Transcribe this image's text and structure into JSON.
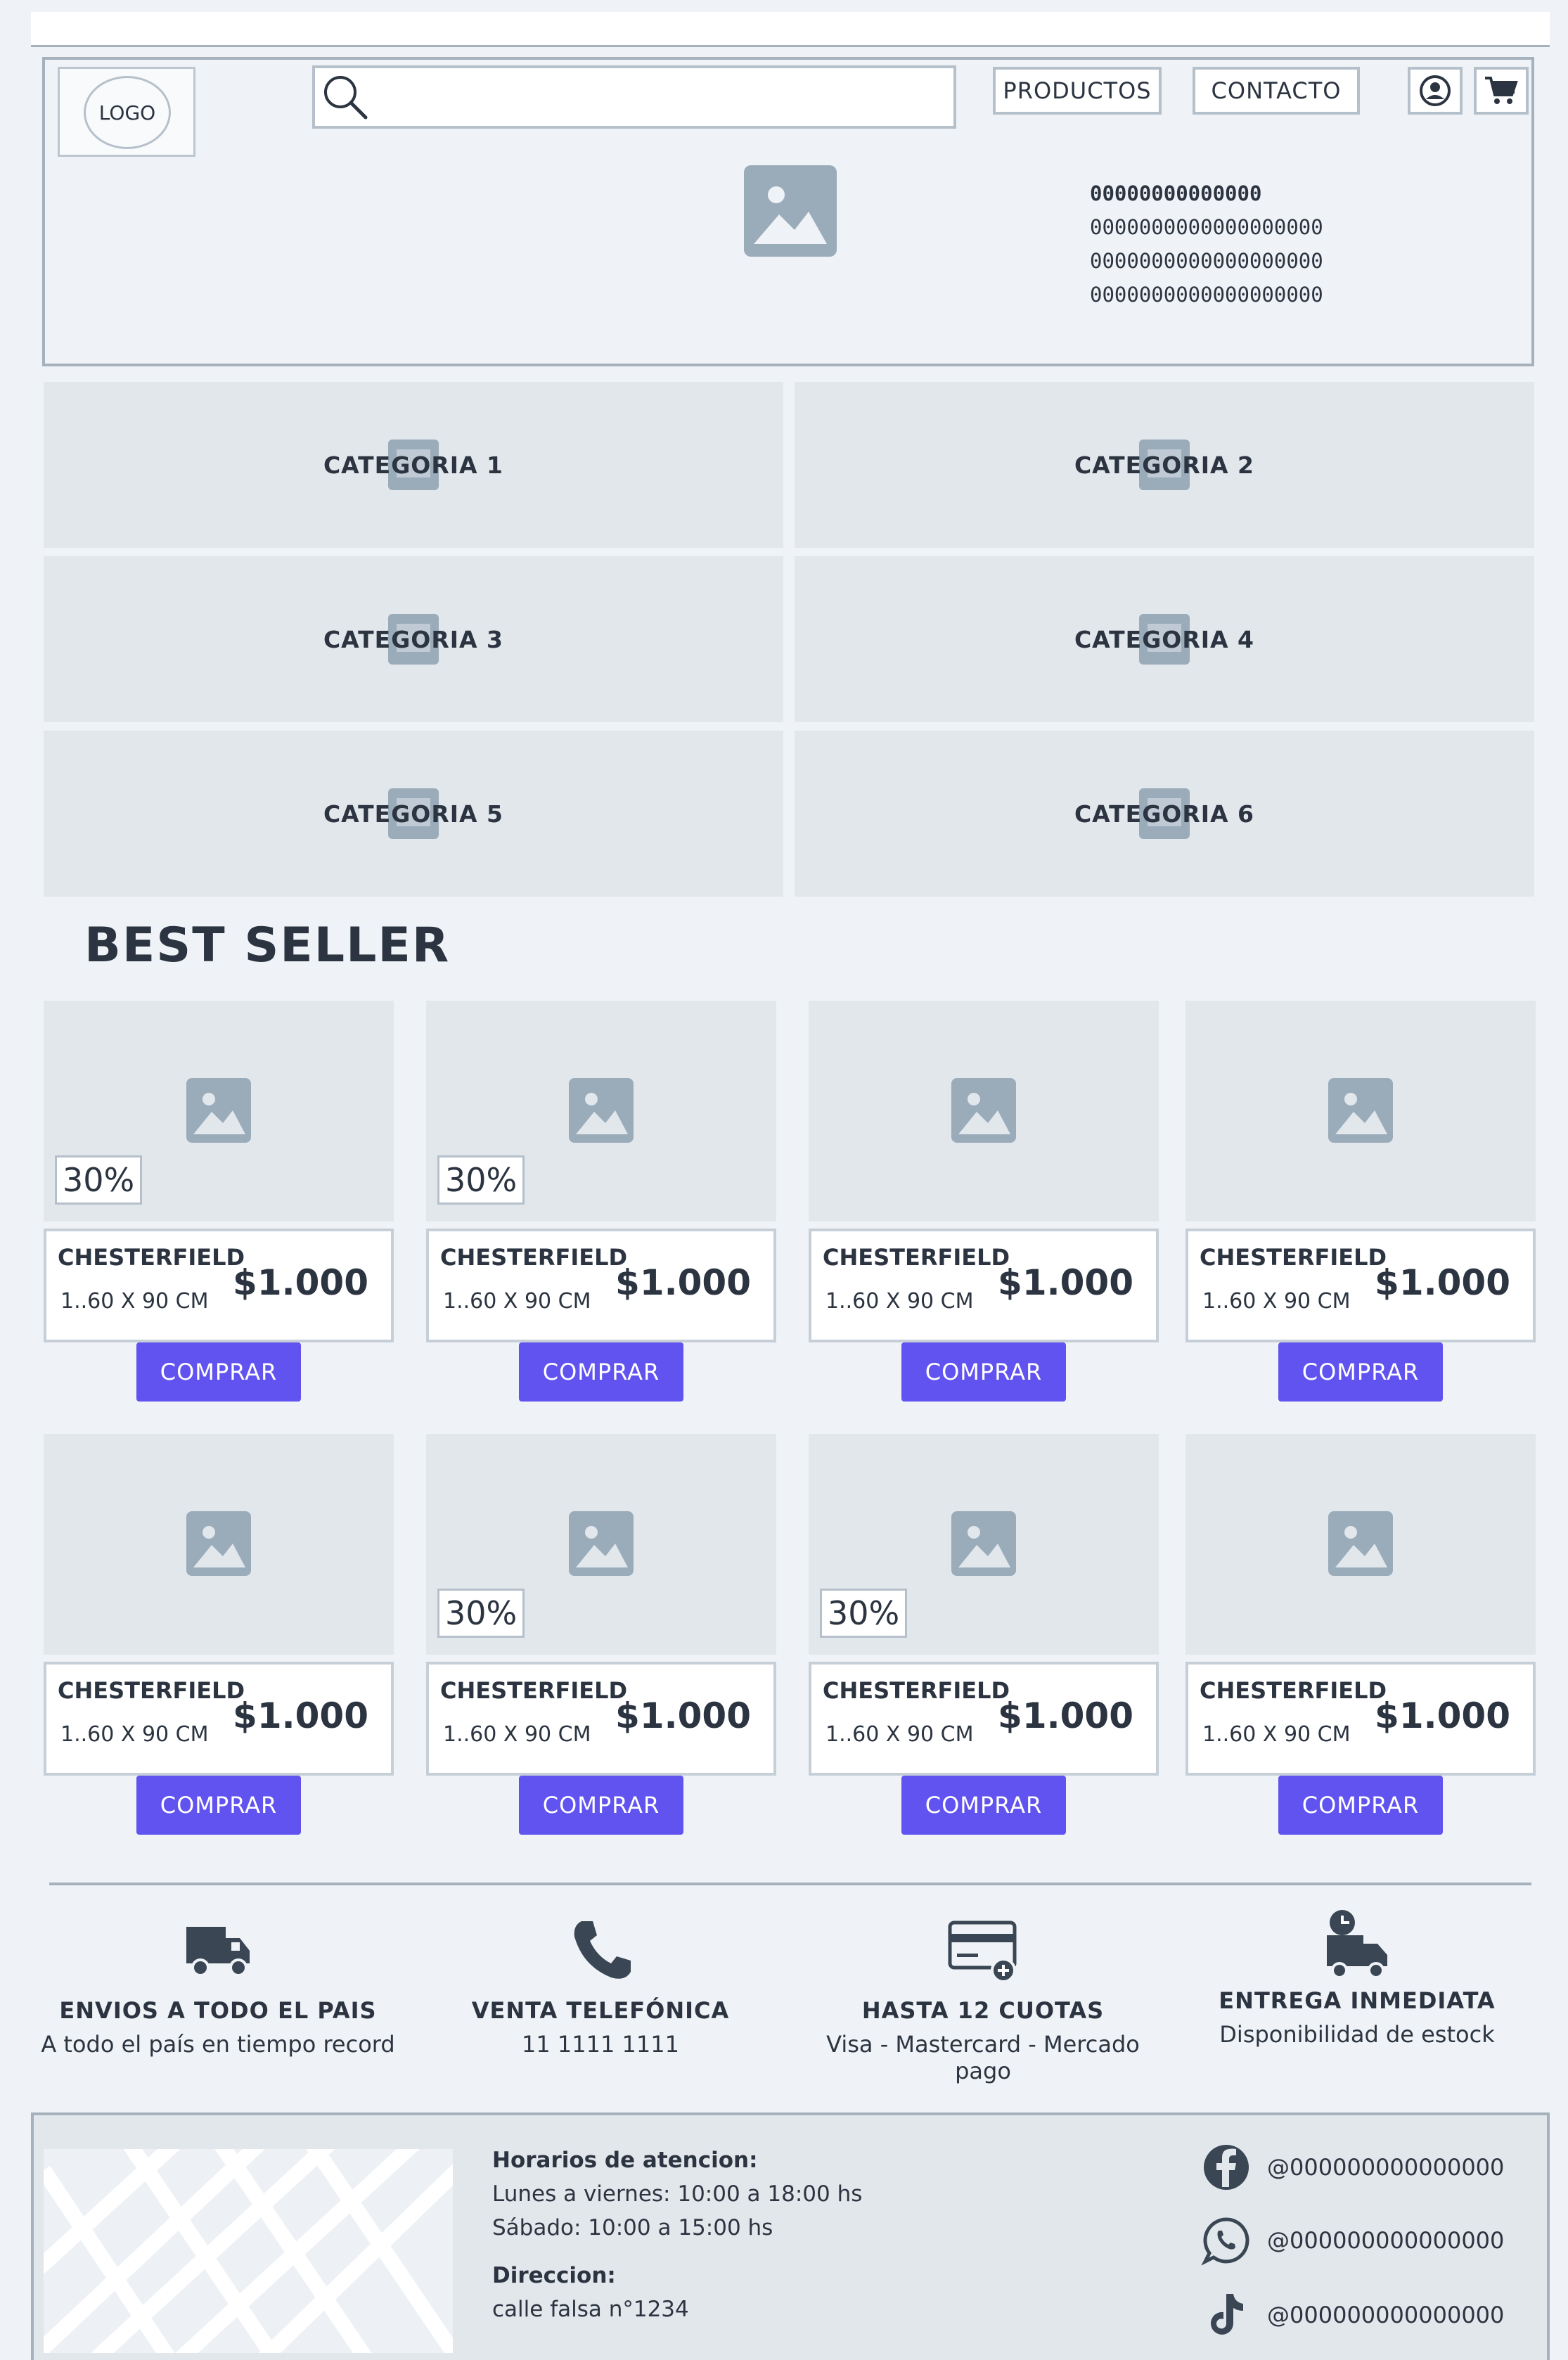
{
  "header": {
    "logo": "LOGO",
    "nav": [
      "PRODUCTOS",
      "CONTACTO"
    ],
    "hero_lines": [
      "00000000000000",
      "0000000000000000000",
      "0000000000000000000",
      "0000000000000000000"
    ]
  },
  "categories": [
    "CATEGORIA 1",
    "CATEGORIA 2",
    "CATEGORIA 3",
    "CATEGORIA 4",
    "CATEGORIA 5",
    "CATEGORIA 6"
  ],
  "best_seller": {
    "title": "BEST SELLER",
    "products": [
      {
        "discount": "30%",
        "name": "CHESTERFIELD",
        "size": "1..60 X 90 CM",
        "price": "$1.000",
        "button": "COMPRAR"
      },
      {
        "discount": "30%",
        "name": "CHESTERFIELD",
        "size": "1..60 X 90 CM",
        "price": "$1.000",
        "button": "COMPRAR"
      },
      {
        "discount": "",
        "name": "CHESTERFIELD",
        "size": "1..60 X 90 CM",
        "price": "$1.000",
        "button": "COMPRAR"
      },
      {
        "discount": "",
        "name": "CHESTERFIELD",
        "size": "1..60 X 90 CM",
        "price": "$1.000",
        "button": "COMPRAR"
      },
      {
        "discount": "",
        "name": "CHESTERFIELD",
        "size": "1..60 X 90 CM",
        "price": "$1.000",
        "button": "COMPRAR"
      },
      {
        "discount": "30%",
        "name": "CHESTERFIELD",
        "size": "1..60 X 90 CM",
        "price": "$1.000",
        "button": "COMPRAR"
      },
      {
        "discount": "30%",
        "name": "CHESTERFIELD",
        "size": "1..60 X 90 CM",
        "price": "$1.000",
        "button": "COMPRAR"
      },
      {
        "discount": "",
        "name": "CHESTERFIELD",
        "size": "1..60 X 90 CM",
        "price": "$1.000",
        "button": "COMPRAR"
      }
    ]
  },
  "features": [
    {
      "icon": "truck-icon",
      "title": "ENVIOS A TODO EL PAIS",
      "desc": "A todo el país en tiempo record"
    },
    {
      "icon": "phone-icon",
      "title": "VENTA TELEFÓNICA",
      "desc": "11 1111 1111"
    },
    {
      "icon": "credit-card-icon",
      "title": "HASTA 12 CUOTAS",
      "desc": "Visa - Mastercard - Mercado pago"
    },
    {
      "icon": "delivery-clock-icon",
      "title": "ENTREGA INMEDIATA",
      "desc": "Disponibilidad de estock"
    }
  ],
  "footer": {
    "hours_title": "Horarios de atencion:",
    "hours_weekdays": "Lunes a viernes: 10:00 a 18:00 hs",
    "hours_saturday": "Sábado: 10:00 a 15:00 hs",
    "address_title": "Direccion:",
    "address": "calle falsa n°1234",
    "social": [
      {
        "icon": "facebook-icon",
        "handle": "@000000000000000"
      },
      {
        "icon": "whatsapp-icon",
        "handle": "@000000000000000"
      },
      {
        "icon": "tiktok-icon",
        "handle": "@000000000000000"
      }
    ]
  },
  "colors": {
    "accent": "#6153ef",
    "background": "#eff3f7",
    "panel": "#e2e7ec",
    "border": "#a5b1bd",
    "text": "#2b3440"
  }
}
